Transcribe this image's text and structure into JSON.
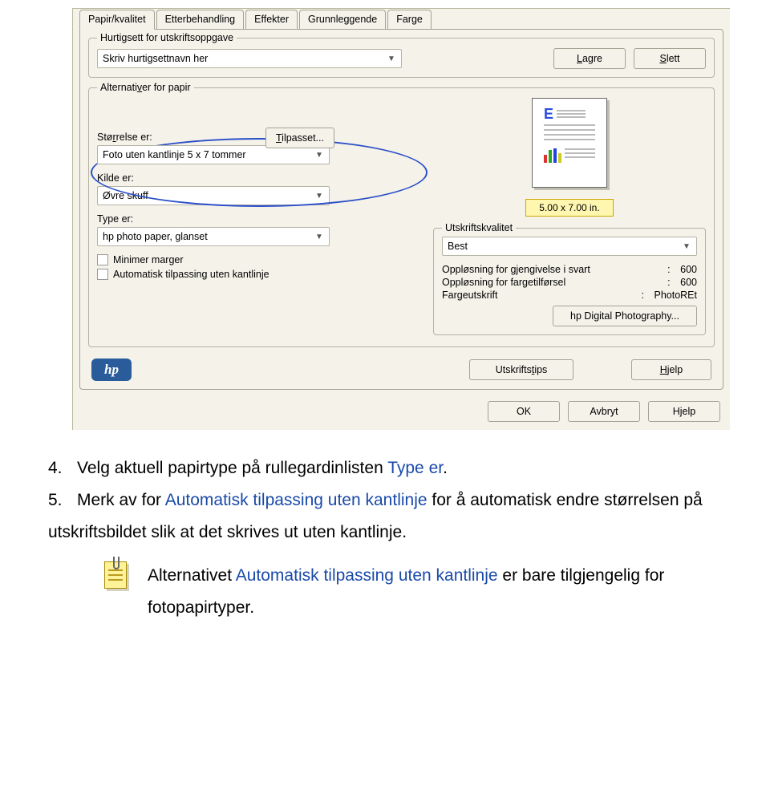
{
  "tabs": {
    "paper_quality": "Papir/kvalitet",
    "finishing": "Etterbehandling",
    "effects": "Effekter",
    "basic": "Grunnleggende",
    "color": "Farge"
  },
  "quickset": {
    "legend": "Hurtigsett for utskriftsoppgave",
    "value": "Skriv hurtigsettnavn her",
    "save": "Lagre",
    "delete": "Slett",
    "save_u": "L",
    "delete_u": "S"
  },
  "paper": {
    "legend": "Alternativer for papir",
    "size_label": "Størrelse er:",
    "size_value": "Foto uten kantlinje 5 x 7 tommer",
    "custom": "Tilpasset...",
    "custom_u": "T",
    "source_label": "Kilde er:",
    "source_u": "K",
    "source_value": "Øvre skuff",
    "type_label": "Type er:",
    "type_value": "hp photo paper, glanset",
    "minimize_margins": "Minimer marger",
    "minimize_u": "n",
    "auto_fit": "Automatisk tilpassing uten kantlinje",
    "auto_fit_u": "A"
  },
  "preview": {
    "size_text": "5.00 x 7.00 in."
  },
  "quality": {
    "legend": "Utskriftskvalitet",
    "value": "Best",
    "black_res_label": "Oppløsning for gjengivelse i svart",
    "black_res_value": "600",
    "color_res_label": "Oppløsning for fargetilførsel",
    "color_res_value": "600",
    "color_print_label": "Fargeutskrift",
    "color_print_value": "PhotoREt",
    "digital_photo": "hp Digital Photography..."
  },
  "footer": {
    "tips": "Utskriftstips",
    "tips_u": "t",
    "help": "Hjelp",
    "help_u": "H"
  },
  "dialog_buttons": {
    "ok": "OK",
    "cancel": "Avbryt",
    "help": "Hjelp"
  },
  "doc": {
    "step4_num": "4.",
    "step4_a": "Velg aktuell papirtype på rullegardinlisten ",
    "step4_link": "Type er",
    "step4_b": ".",
    "step5_num": "5.",
    "step5_a": "Merk av for ",
    "step5_link": "Automatisk tilpassing uten kantlinje",
    "step5_b": " for å automatisk endre størrelsen på utskriftsbildet slik at det skrives ut uten kantlinje.",
    "note_a": "Alternativet ",
    "note_link": "Automatisk tilpassing uten kantlinje",
    "note_b": " er bare tilgjengelig for fotopapirtyper."
  }
}
